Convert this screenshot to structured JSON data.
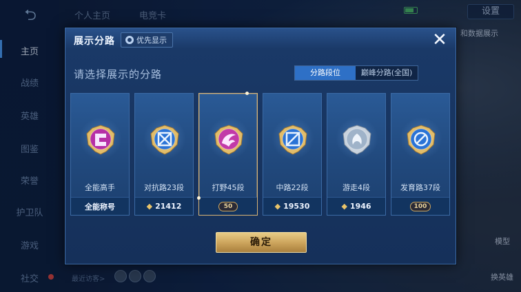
{
  "nav": {
    "items": [
      {
        "label": "主页",
        "active": true
      },
      {
        "label": "战绩"
      },
      {
        "label": "英雄"
      },
      {
        "label": "图鉴"
      },
      {
        "label": "荣誉"
      },
      {
        "label": "护卫队"
      },
      {
        "label": "游戏"
      },
      {
        "label": "社交"
      }
    ]
  },
  "top_tabs": [
    "个人主页",
    "电竞卡"
  ],
  "top_right": {
    "settings_label": "设置",
    "partial_text": "和数据展示"
  },
  "bottom_left": {
    "visitors_label": "最近访客>"
  },
  "right_side": {
    "model_label": "模型",
    "switch_hero_label": "换英雄"
  },
  "modal": {
    "title": "展示分路",
    "priority_label": "优先显示",
    "subtitle": "请选择展示的分路",
    "segments": [
      {
        "label": "分路段位",
        "active": true
      },
      {
        "label": "巅峰分路(全国)",
        "active": false
      }
    ],
    "cards": [
      {
        "label": "全能高手",
        "footer": "全能称号",
        "footer_type": "text",
        "badge_color": "#b62fa6",
        "symbol": "all-round"
      },
      {
        "label": "对抗路23段",
        "footer": "21412",
        "footer_type": "points",
        "badge_color": "#2a73d6",
        "symbol": "clash-lane"
      },
      {
        "label": "打野45段",
        "footer": "50",
        "footer_type": "stars",
        "badge_color": "#c23aa8",
        "symbol": "jungle",
        "selected": true
      },
      {
        "label": "中路22段",
        "footer": "19530",
        "footer_type": "points",
        "badge_color": "#2a73d6",
        "symbol": "mid-lane"
      },
      {
        "label": "游走4段",
        "footer": "1946",
        "footer_type": "points",
        "badge_color": "#9fb3c9",
        "symbol": "roam"
      },
      {
        "label": "发育路37段",
        "footer": "100",
        "footer_type": "stars",
        "badge_color": "#2a73d6",
        "symbol": "farm-lane"
      }
    ],
    "confirm_label": "确定"
  },
  "colors": {
    "accent_blue": "#2e70c6",
    "gold": "#d9b577",
    "modal_bg": "#183561"
  }
}
